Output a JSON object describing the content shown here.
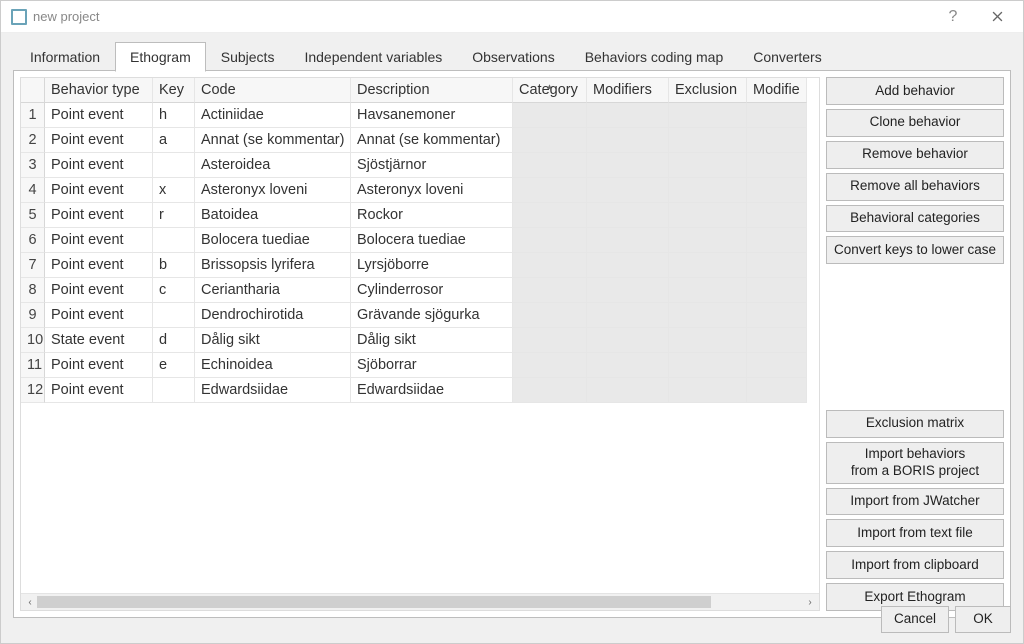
{
  "window": {
    "title": "new project"
  },
  "tabs": [
    "Information",
    "Ethogram",
    "Subjects",
    "Independent variables",
    "Observations",
    "Behaviors coding map",
    "Converters"
  ],
  "active_tab": 1,
  "columns": [
    "Behavior type",
    "Key",
    "Code",
    "Description",
    "Category",
    "Modifiers",
    "Exclusion",
    "Modifie"
  ],
  "sorted_col": 4,
  "rows": [
    {
      "n": 1,
      "type": "Point event",
      "key": "h",
      "code": "Actiniidae",
      "desc": "Havsanemoner"
    },
    {
      "n": 2,
      "type": "Point event",
      "key": "a",
      "code": "Annat (se kommentar)",
      "desc": "Annat (se kommentar)"
    },
    {
      "n": 3,
      "type": "Point event",
      "key": "",
      "code": "Asteroidea",
      "desc": "Sjöstjärnor"
    },
    {
      "n": 4,
      "type": "Point event",
      "key": "x",
      "code": "Asteronyx loveni",
      "desc": "Asteronyx loveni"
    },
    {
      "n": 5,
      "type": "Point event",
      "key": "r",
      "code": "Batoidea",
      "desc": "Rockor"
    },
    {
      "n": 6,
      "type": "Point event",
      "key": "",
      "code": "Bolocera tuediae",
      "desc": "Bolocera tuediae"
    },
    {
      "n": 7,
      "type": "Point event",
      "key": "b",
      "code": "Brissopsis lyrifera",
      "desc": "Lyrsjöborre"
    },
    {
      "n": 8,
      "type": "Point event",
      "key": "c",
      "code": "Ceriantharia",
      "desc": "Cylinderrosor"
    },
    {
      "n": 9,
      "type": "Point event",
      "key": "",
      "code": "Dendrochirotida",
      "desc": "Grävande sjögurka"
    },
    {
      "n": 10,
      "type": "State event",
      "key": "d",
      "code": "Dålig sikt",
      "desc": "Dålig sikt"
    },
    {
      "n": 11,
      "type": "Point event",
      "key": "e",
      "code": "Echinoidea",
      "desc": "Sjöborrar"
    },
    {
      "n": 12,
      "type": "Point event",
      "key": "",
      "code": "Edwardsiidae",
      "desc": "Edwardsiidae"
    }
  ],
  "sidebar_top": [
    "Add behavior",
    "Clone behavior",
    "Remove behavior",
    "Remove all behaviors",
    "Behavioral categories",
    "Convert keys to lower case"
  ],
  "sidebar_bottom": [
    "Exclusion matrix",
    "Import behaviors\nfrom a BORIS project",
    "Import from JWatcher",
    "Import from text file",
    "Import from clipboard",
    "Export Ethogram"
  ],
  "dialog": {
    "cancel": "Cancel",
    "ok": "OK"
  }
}
